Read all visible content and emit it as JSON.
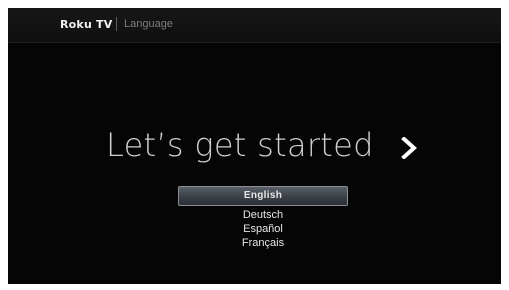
{
  "header": {
    "brand": "Roku TV",
    "section": "Language"
  },
  "main": {
    "headline": "Let’s get started",
    "next_icon": "chevron-right-icon"
  },
  "languages": {
    "selected": "English",
    "items": [
      "Deutsch",
      "Español",
      "Français"
    ]
  },
  "colors": {
    "background": "#050505",
    "headline": "#cfcfcf",
    "highlight": "#3b4047"
  }
}
